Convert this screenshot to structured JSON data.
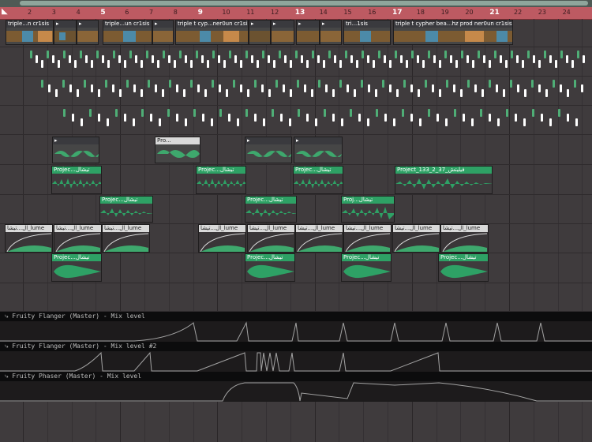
{
  "colors": {
    "background": "#3f3b3d",
    "ruler": "#bd5a62",
    "audio_green": "#2ea165",
    "header_white": "#d9d9d9",
    "lane_header": "#0c0c0d"
  },
  "ruler": {
    "marker_icon": "playhead-marker-icon",
    "bars": [
      "2",
      "3",
      "4",
      "5",
      "6",
      "7",
      "8",
      "9",
      "10",
      "11",
      "12",
      "13",
      "14",
      "15",
      "16",
      "17",
      "18",
      "19",
      "20",
      "21",
      "22",
      "23",
      "24"
    ]
  },
  "clips": {
    "chords": [
      "triple...n cr1sis",
      "triple...un cr1sis",
      "triple t cyp...ner0un cr1sis",
      "tri...1sis",
      "triple t cypher bea...hz prod ner0un cr1sis"
    ],
    "pro_small": "Pro...",
    "project_short": "Projec...تیشال",
    "project_long": "Project_133_2_37_فیلیتش",
    "proj_medium": "Proj...تیشال",
    "volume": "ال...تیشا_lume"
  },
  "automation": [
    "Fruity Flanger (Master) - Mix level",
    "Fruity Flanger (Master) - Mix level #2",
    "Fruity Phaser (Master) - Mix level"
  ]
}
